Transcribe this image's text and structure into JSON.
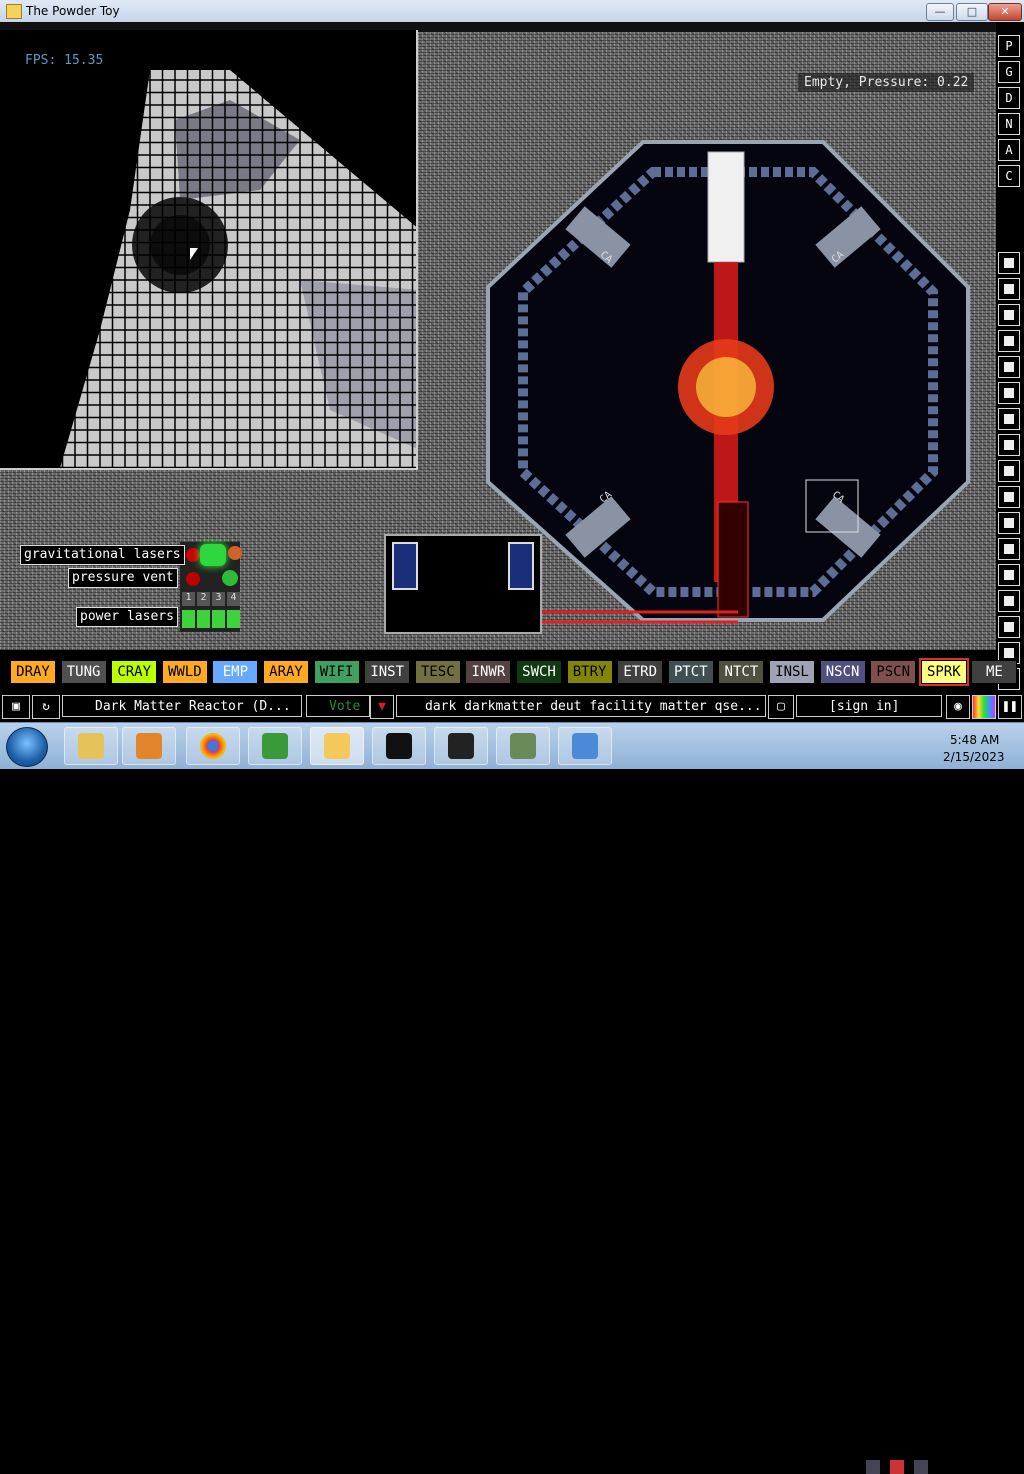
{
  "window": {
    "title": "The Powder Toy",
    "min": "—",
    "max": "□",
    "close": "✕"
  },
  "overlay": {
    "fps": "FPS: 15.35",
    "hover_info": "Empty, Pressure: 0.22"
  },
  "signs": {
    "grav": "gravitational lasers",
    "vent": "pressure vent",
    "power": "power lasers",
    "numbers": [
      "1",
      "2",
      "3",
      "4"
    ],
    "can1": "CA",
    "can2": "CA",
    "can3": "CA",
    "can4": "CA"
  },
  "menu": {
    "top_buttons": [
      "P",
      "G",
      "D",
      "N",
      "A",
      "C"
    ],
    "categories": [
      "wall-icon",
      "electronics-icon",
      "powered-icon",
      "sensors-icon",
      "force-icon",
      "explosives-icon",
      "gases-icon",
      "liquids-icon",
      "powders-icon",
      "solids-icon",
      "radioactive-icon",
      "special-icon",
      "life-icon",
      "tools-icon",
      "favorites-icon",
      "decoration-icon",
      "search-icon"
    ]
  },
  "elements": [
    {
      "name": "DRAY",
      "bg": "#ffaa22",
      "fg": "#000"
    },
    {
      "name": "TUNG",
      "bg": "#505050",
      "fg": "#fff"
    },
    {
      "name": "CRAY",
      "bg": "#bbff00",
      "fg": "#000"
    },
    {
      "name": "WWLD",
      "bg": "#ffaa22",
      "fg": "#000"
    },
    {
      "name": "EMP",
      "bg": "#66aaff",
      "fg": "#fff"
    },
    {
      "name": "ARAY",
      "bg": "#ffaa22",
      "fg": "#000"
    },
    {
      "name": "WIFI",
      "bg": "#40a060",
      "fg": "#000"
    },
    {
      "name": "INST",
      "bg": "#404040",
      "fg": "#fff"
    },
    {
      "name": "TESC",
      "bg": "#707040",
      "fg": "#000"
    },
    {
      "name": "INWR",
      "bg": "#544141",
      "fg": "#fff"
    },
    {
      "name": "SWCH",
      "bg": "#103b11",
      "fg": "#fff"
    },
    {
      "name": "BTRY",
      "bg": "#858505",
      "fg": "#000"
    },
    {
      "name": "ETRD",
      "bg": "#404040",
      "fg": "#fff"
    },
    {
      "name": "PTCT",
      "bg": "#405050",
      "fg": "#fff"
    },
    {
      "name": "NTCT",
      "bg": "#505040",
      "fg": "#fff"
    },
    {
      "name": "INSL",
      "bg": "#9ea3b6",
      "fg": "#000"
    },
    {
      "name": "NSCN",
      "bg": "#505080",
      "fg": "#fff"
    },
    {
      "name": "PSCN",
      "bg": "#805050",
      "fg": "#000"
    },
    {
      "name": "SPRK",
      "bg": "#ffff80",
      "fg": "#000",
      "selected": true
    },
    {
      "name": "ME",
      "bg": "#404040",
      "fg": "#fff"
    }
  ],
  "bottombar": {
    "save_title": "Dark Matter Reactor (D...",
    "vote_label": "Vote",
    "tags": "dark darkmatter deut facility matter qse...",
    "sign_in": "[sign in]"
  },
  "taskbar": {
    "time": "5:48 AM",
    "date": "2/15/2023"
  }
}
